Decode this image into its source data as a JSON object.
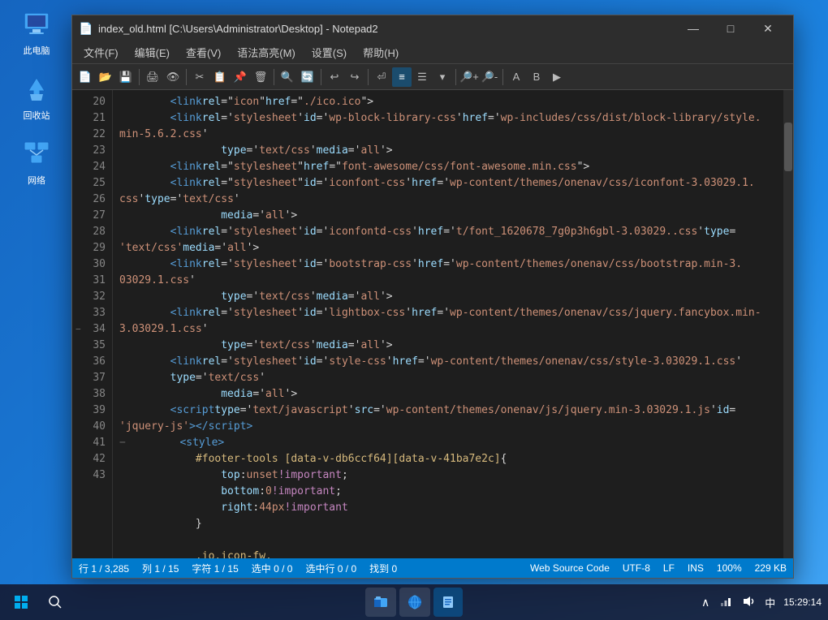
{
  "window": {
    "title": "index_old.html [C:\\Users\\Administrator\\Desktop] - Notepad2",
    "icon": "📄"
  },
  "titlebar": {
    "minimize": "—",
    "maximize": "□",
    "close": "✕"
  },
  "menubar": {
    "items": [
      "文件(F)",
      "编辑(E)",
      "查看(V)",
      "语法高亮(M)",
      "设置(S)",
      "帮助(H)"
    ]
  },
  "lines": [
    {
      "num": 20,
      "content": ""
    },
    {
      "num": 21,
      "content": ""
    },
    {
      "num": 22,
      "content": ""
    },
    {
      "num": 23,
      "content": ""
    },
    {
      "num": 24,
      "content": ""
    },
    {
      "num": 25,
      "content": ""
    },
    {
      "num": 26,
      "content": ""
    },
    {
      "num": 27,
      "content": ""
    },
    {
      "num": 28,
      "content": ""
    },
    {
      "num": 29,
      "content": ""
    },
    {
      "num": 30,
      "content": ""
    },
    {
      "num": 31,
      "content": ""
    },
    {
      "num": 32,
      "content": ""
    },
    {
      "num": 33,
      "content": ""
    },
    {
      "num": 34,
      "content": "",
      "collapsed": true
    },
    {
      "num": 35,
      "content": ""
    },
    {
      "num": 36,
      "content": ""
    },
    {
      "num": 37,
      "content": ""
    },
    {
      "num": 38,
      "content": ""
    },
    {
      "num": 39,
      "content": ""
    },
    {
      "num": 40,
      "content": ""
    },
    {
      "num": 41,
      "content": ""
    },
    {
      "num": 42,
      "content": ""
    },
    {
      "num": 43,
      "content": ""
    }
  ],
  "statusbar": {
    "position": "行 1 / 3,285",
    "col": "列 1 / 15",
    "char": "字符 1 / 15",
    "selection": "选中 0 / 0",
    "lines": "选中行 0 / 0",
    "found": "找到 0",
    "lang": "Web Source Code",
    "encoding": "UTF-8",
    "eol": "LF",
    "mode": "INS",
    "zoom": "100%",
    "size": "229 KB"
  },
  "taskbar": {
    "start_icon": "⊞",
    "search_icon": "🔍",
    "time": "15:29:14",
    "date": "",
    "apps": [
      {
        "label": "📁"
      },
      {
        "label": "🌐"
      },
      {
        "label": "📋"
      }
    ],
    "tray": {
      "chevron": "∧",
      "network": "🌐",
      "volume": "🔊",
      "ime": "中",
      "time": "15:29:14"
    }
  },
  "desktop_icons": [
    {
      "label": "此电脑",
      "icon": "💻"
    },
    {
      "label": "回收站",
      "icon": "🗑️"
    },
    {
      "label": "网络",
      "icon": "🖥️"
    }
  ]
}
